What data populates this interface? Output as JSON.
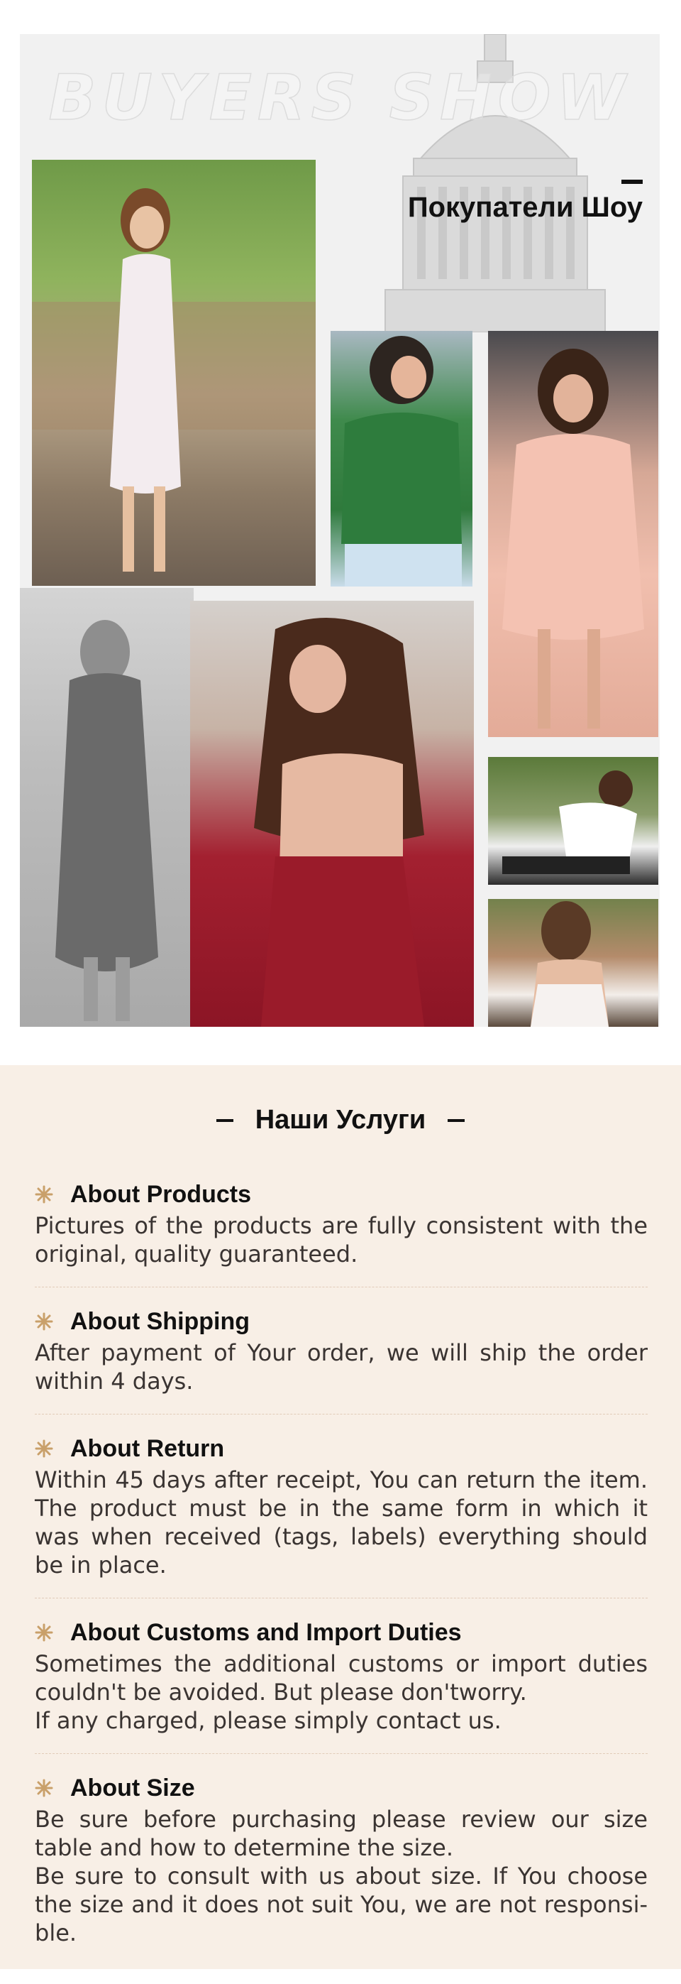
{
  "show": {
    "watermark": "BUYERS SHOW",
    "title": "Покупатели Шоу"
  },
  "services": {
    "title": "Наши Услуги",
    "items": [
      {
        "heading": "About Products",
        "text": "Pictures of the products are fully consistent with the original, quality guaranteed."
      },
      {
        "heading": "About Shipping",
        "text": "After payment of Your order, we will ship the order within 4 days."
      },
      {
        "heading": "About Return",
        "text": "Within 45 days after receipt, You can return the item. The product must be in the same form in which it was when received (tags, labels) everything should be in place."
      },
      {
        "heading": "About Customs and Import Duties",
        "text": "Sometimes the additional customs or import duties couldn't be avoided. But please don'tworry.\nIf any charged, please simply contact us."
      },
      {
        "heading": "About Size",
        "text": "Be sure before purchasing please review our size table and how to determine the size.\nBe sure to consult with us about size. If You choose the size and it does not suit You, we are not responsi-ble."
      }
    ]
  },
  "colors": {
    "services_bg": "#f8efe6",
    "star": "#c9a06a",
    "heading": "#111111",
    "text": "#3a3432"
  },
  "icons": [
    "star-icon",
    "capitol-building-icon"
  ]
}
